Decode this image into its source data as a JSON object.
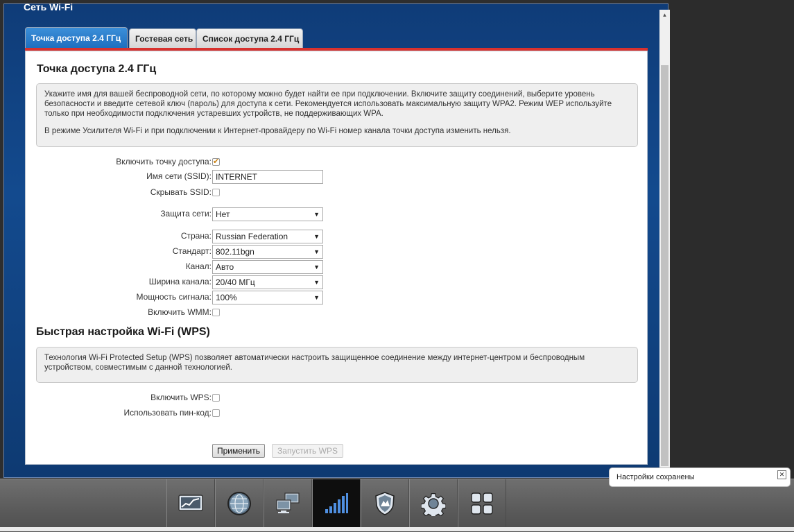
{
  "window": {
    "title": "Сеть Wi-Fi"
  },
  "tabs": [
    {
      "label": "Точка доступа 2.4 ГГц",
      "active": true
    },
    {
      "label": "Гостевая сеть",
      "active": false
    },
    {
      "label": "Список доступа 2.4 ГГц",
      "active": false
    }
  ],
  "ap_section": {
    "title": "Точка доступа 2.4 ГГц",
    "info_p1": "Укажите имя для вашей беспроводной сети, по которому можно будет найти ее при подключении. Включите защиту соединений, выберите уровень безопасности и введите сетевой ключ (пароль) для доступа к сети. Рекомендуется использовать максимальную защиту WPA2. Режим WEP используйте только при необходимости подключения устаревших устройств, не поддерживающих WPA.",
    "info_p2": "В режиме Усилителя Wi-Fi и при подключении к Интернет-провайдеру по Wi-Fi номер канала точки доступа изменить нельзя."
  },
  "form": {
    "enable_ap_label": "Включить точку доступа:",
    "enable_ap_checked": true,
    "ssid_label": "Имя сети (SSID):",
    "ssid_value": "INTERNET",
    "hide_ssid_label": "Скрывать SSID:",
    "hide_ssid_checked": false,
    "security_label": "Защита сети:",
    "security_value": "Нет",
    "country_label": "Страна:",
    "country_value": "Russian Federation",
    "standard_label": "Стандарт:",
    "standard_value": "802.11bgn",
    "channel_label": "Канал:",
    "channel_value": "Авто",
    "width_label": "Ширина канала:",
    "width_value": "20/40 МГц",
    "power_label": "Мощность сигнала:",
    "power_value": "100%",
    "wmm_label": "Включить WMM:",
    "wmm_checked": false
  },
  "wps_section": {
    "title": "Быстрая настройка Wi-Fi (WPS)",
    "info": "Технология Wi-Fi Protected Setup (WPS) позволяет автоматически настроить защищенное соединение между интернет-центром и беспроводным устройством, совместимым с данной технологией.",
    "enable_wps_label": "Включить WPS:",
    "enable_wps_checked": false,
    "use_pin_label": "Использовать пин-код:",
    "use_pin_checked": false
  },
  "buttons": {
    "apply": "Применить",
    "start_wps": "Запустить WPS"
  },
  "taskbar": {
    "items": [
      {
        "icon": "monitor-chart-icon",
        "active": false
      },
      {
        "icon": "globe-icon",
        "active": false
      },
      {
        "icon": "network-computers-icon",
        "active": false
      },
      {
        "icon": "wifi-signal-bars-icon",
        "active": true
      },
      {
        "icon": "shield-icon",
        "active": false
      },
      {
        "icon": "gear-icon",
        "active": false
      },
      {
        "icon": "apps-grid-icon",
        "active": false
      }
    ]
  },
  "toast": {
    "text": "Настройки сохранены"
  },
  "colors": {
    "accent_red": "#d8322e",
    "tab_active": "#2a7fd0",
    "window_blue": "#134a8e"
  }
}
